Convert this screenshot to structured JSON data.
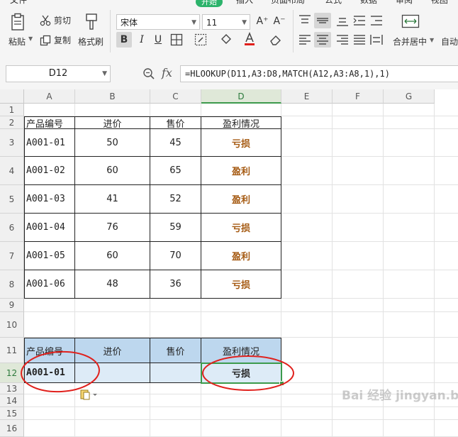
{
  "menu": [
    {
      "label": "文件"
    },
    {
      "label": "开始",
      "active": true
    },
    {
      "label": "插入"
    },
    {
      "label": "页面布局"
    },
    {
      "label": "公式"
    },
    {
      "label": "数据"
    },
    {
      "label": "审阅"
    },
    {
      "label": "视图"
    }
  ],
  "ribbon": {
    "paste": "粘贴",
    "cut": "剪切",
    "copy": "复制",
    "format_painter": "格式刷",
    "font_name": "宋体",
    "font_size": "11",
    "font_grow": "A⁺",
    "font_shrink": "A⁻",
    "bold": "B",
    "italic": "I",
    "underline": "U",
    "merge_center": "合并居中",
    "auto_wrap": "自动"
  },
  "formula_bar": {
    "name_box": "D12",
    "fx": "fx",
    "formula": "=HLOOKUP(D11,A3:D8,MATCH(A12,A3:A8,1),1)"
  },
  "columns": [
    "A",
    "B",
    "C",
    "D",
    "E",
    "F",
    "G"
  ],
  "rows": [
    "1",
    "2",
    "3",
    "4",
    "5",
    "6",
    "7",
    "8",
    "9",
    "10",
    "11",
    "12",
    "13",
    "14",
    "15",
    "16"
  ],
  "table1": {
    "headers": [
      "产品编号",
      "进价",
      "售价",
      "盈利情况"
    ],
    "rows": [
      [
        "A001-01",
        "50",
        "45",
        "亏损"
      ],
      [
        "A001-02",
        "60",
        "65",
        "盈利"
      ],
      [
        "A001-03",
        "41",
        "52",
        "盈利"
      ],
      [
        "A001-04",
        "76",
        "59",
        "亏损"
      ],
      [
        "A001-05",
        "60",
        "70",
        "盈利"
      ],
      [
        "A001-06",
        "48",
        "36",
        "亏损"
      ]
    ]
  },
  "table2": {
    "headers": [
      "产品编号",
      "进价",
      "售价",
      "盈利情况"
    ],
    "row": [
      "A001-01",
      "",
      "",
      "亏损"
    ]
  },
  "colors": {
    "accent": "#2cb36b",
    "profit_text": "#a55a12",
    "lookup_header_bg": "#bdd7ee",
    "lookup_row_bg": "#ddebf7",
    "annotation": "#e0201c",
    "selection": "#3c9a4c"
  },
  "watermark": "Bai 经验 jingyan.baidu.com"
}
